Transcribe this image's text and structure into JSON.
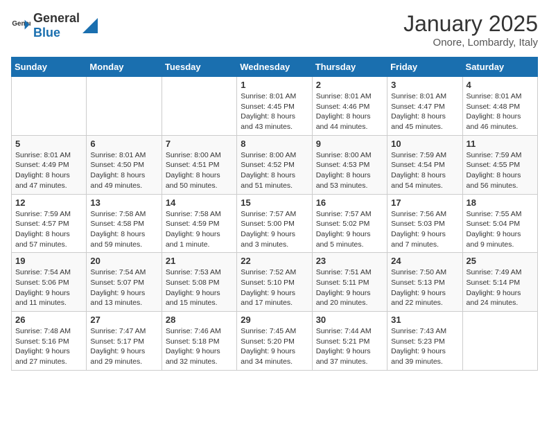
{
  "header": {
    "logo_general": "General",
    "logo_blue": "Blue",
    "month": "January 2025",
    "location": "Onore, Lombardy, Italy"
  },
  "days_of_week": [
    "Sunday",
    "Monday",
    "Tuesday",
    "Wednesday",
    "Thursday",
    "Friday",
    "Saturday"
  ],
  "weeks": [
    [
      {
        "day": "",
        "info": ""
      },
      {
        "day": "",
        "info": ""
      },
      {
        "day": "",
        "info": ""
      },
      {
        "day": "1",
        "info": "Sunrise: 8:01 AM\nSunset: 4:45 PM\nDaylight: 8 hours\nand 43 minutes."
      },
      {
        "day": "2",
        "info": "Sunrise: 8:01 AM\nSunset: 4:46 PM\nDaylight: 8 hours\nand 44 minutes."
      },
      {
        "day": "3",
        "info": "Sunrise: 8:01 AM\nSunset: 4:47 PM\nDaylight: 8 hours\nand 45 minutes."
      },
      {
        "day": "4",
        "info": "Sunrise: 8:01 AM\nSunset: 4:48 PM\nDaylight: 8 hours\nand 46 minutes."
      }
    ],
    [
      {
        "day": "5",
        "info": "Sunrise: 8:01 AM\nSunset: 4:49 PM\nDaylight: 8 hours\nand 47 minutes."
      },
      {
        "day": "6",
        "info": "Sunrise: 8:01 AM\nSunset: 4:50 PM\nDaylight: 8 hours\nand 49 minutes."
      },
      {
        "day": "7",
        "info": "Sunrise: 8:00 AM\nSunset: 4:51 PM\nDaylight: 8 hours\nand 50 minutes."
      },
      {
        "day": "8",
        "info": "Sunrise: 8:00 AM\nSunset: 4:52 PM\nDaylight: 8 hours\nand 51 minutes."
      },
      {
        "day": "9",
        "info": "Sunrise: 8:00 AM\nSunset: 4:53 PM\nDaylight: 8 hours\nand 53 minutes."
      },
      {
        "day": "10",
        "info": "Sunrise: 7:59 AM\nSunset: 4:54 PM\nDaylight: 8 hours\nand 54 minutes."
      },
      {
        "day": "11",
        "info": "Sunrise: 7:59 AM\nSunset: 4:55 PM\nDaylight: 8 hours\nand 56 minutes."
      }
    ],
    [
      {
        "day": "12",
        "info": "Sunrise: 7:59 AM\nSunset: 4:57 PM\nDaylight: 8 hours\nand 57 minutes."
      },
      {
        "day": "13",
        "info": "Sunrise: 7:58 AM\nSunset: 4:58 PM\nDaylight: 8 hours\nand 59 minutes."
      },
      {
        "day": "14",
        "info": "Sunrise: 7:58 AM\nSunset: 4:59 PM\nDaylight: 9 hours\nand 1 minute."
      },
      {
        "day": "15",
        "info": "Sunrise: 7:57 AM\nSunset: 5:00 PM\nDaylight: 9 hours\nand 3 minutes."
      },
      {
        "day": "16",
        "info": "Sunrise: 7:57 AM\nSunset: 5:02 PM\nDaylight: 9 hours\nand 5 minutes."
      },
      {
        "day": "17",
        "info": "Sunrise: 7:56 AM\nSunset: 5:03 PM\nDaylight: 9 hours\nand 7 minutes."
      },
      {
        "day": "18",
        "info": "Sunrise: 7:55 AM\nSunset: 5:04 PM\nDaylight: 9 hours\nand 9 minutes."
      }
    ],
    [
      {
        "day": "19",
        "info": "Sunrise: 7:54 AM\nSunset: 5:06 PM\nDaylight: 9 hours\nand 11 minutes."
      },
      {
        "day": "20",
        "info": "Sunrise: 7:54 AM\nSunset: 5:07 PM\nDaylight: 9 hours\nand 13 minutes."
      },
      {
        "day": "21",
        "info": "Sunrise: 7:53 AM\nSunset: 5:08 PM\nDaylight: 9 hours\nand 15 minutes."
      },
      {
        "day": "22",
        "info": "Sunrise: 7:52 AM\nSunset: 5:10 PM\nDaylight: 9 hours\nand 17 minutes."
      },
      {
        "day": "23",
        "info": "Sunrise: 7:51 AM\nSunset: 5:11 PM\nDaylight: 9 hours\nand 20 minutes."
      },
      {
        "day": "24",
        "info": "Sunrise: 7:50 AM\nSunset: 5:13 PM\nDaylight: 9 hours\nand 22 minutes."
      },
      {
        "day": "25",
        "info": "Sunrise: 7:49 AM\nSunset: 5:14 PM\nDaylight: 9 hours\nand 24 minutes."
      }
    ],
    [
      {
        "day": "26",
        "info": "Sunrise: 7:48 AM\nSunset: 5:16 PM\nDaylight: 9 hours\nand 27 minutes."
      },
      {
        "day": "27",
        "info": "Sunrise: 7:47 AM\nSunset: 5:17 PM\nDaylight: 9 hours\nand 29 minutes."
      },
      {
        "day": "28",
        "info": "Sunrise: 7:46 AM\nSunset: 5:18 PM\nDaylight: 9 hours\nand 32 minutes."
      },
      {
        "day": "29",
        "info": "Sunrise: 7:45 AM\nSunset: 5:20 PM\nDaylight: 9 hours\nand 34 minutes."
      },
      {
        "day": "30",
        "info": "Sunrise: 7:44 AM\nSunset: 5:21 PM\nDaylight: 9 hours\nand 37 minutes."
      },
      {
        "day": "31",
        "info": "Sunrise: 7:43 AM\nSunset: 5:23 PM\nDaylight: 9 hours\nand 39 minutes."
      },
      {
        "day": "",
        "info": ""
      }
    ]
  ]
}
